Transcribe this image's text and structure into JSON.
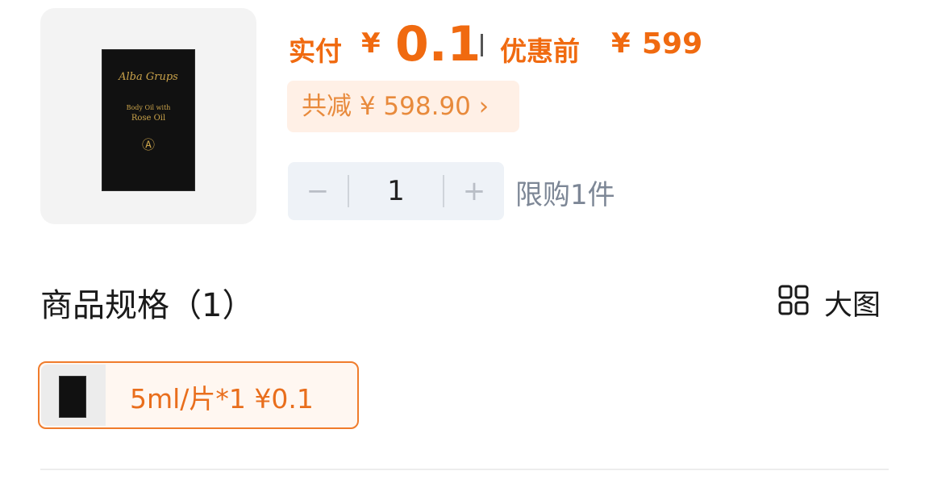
{
  "product": {
    "sachet_brand": "Alba Grups",
    "sachet_line1": "Body Oil with",
    "sachet_line2": "Rose Oil"
  },
  "price": {
    "paid_label": "实付",
    "currency": "¥",
    "paid_value": "0.1",
    "before_label": "优惠前",
    "before_value": "599"
  },
  "discount": {
    "text": "共减 ¥ 598.90 ›"
  },
  "stepper": {
    "minus": "−",
    "quantity": "1",
    "plus": "+"
  },
  "limit_text": "限购1件",
  "spec": {
    "title": "商品规格（1）",
    "big_image_label": "大图",
    "items": [
      {
        "label": "5ml/片*1  ¥0.1"
      }
    ]
  },
  "colors": {
    "accent": "#f06a10",
    "discount_bg": "#fff0e6",
    "stepper_bg": "#eef2f7"
  }
}
